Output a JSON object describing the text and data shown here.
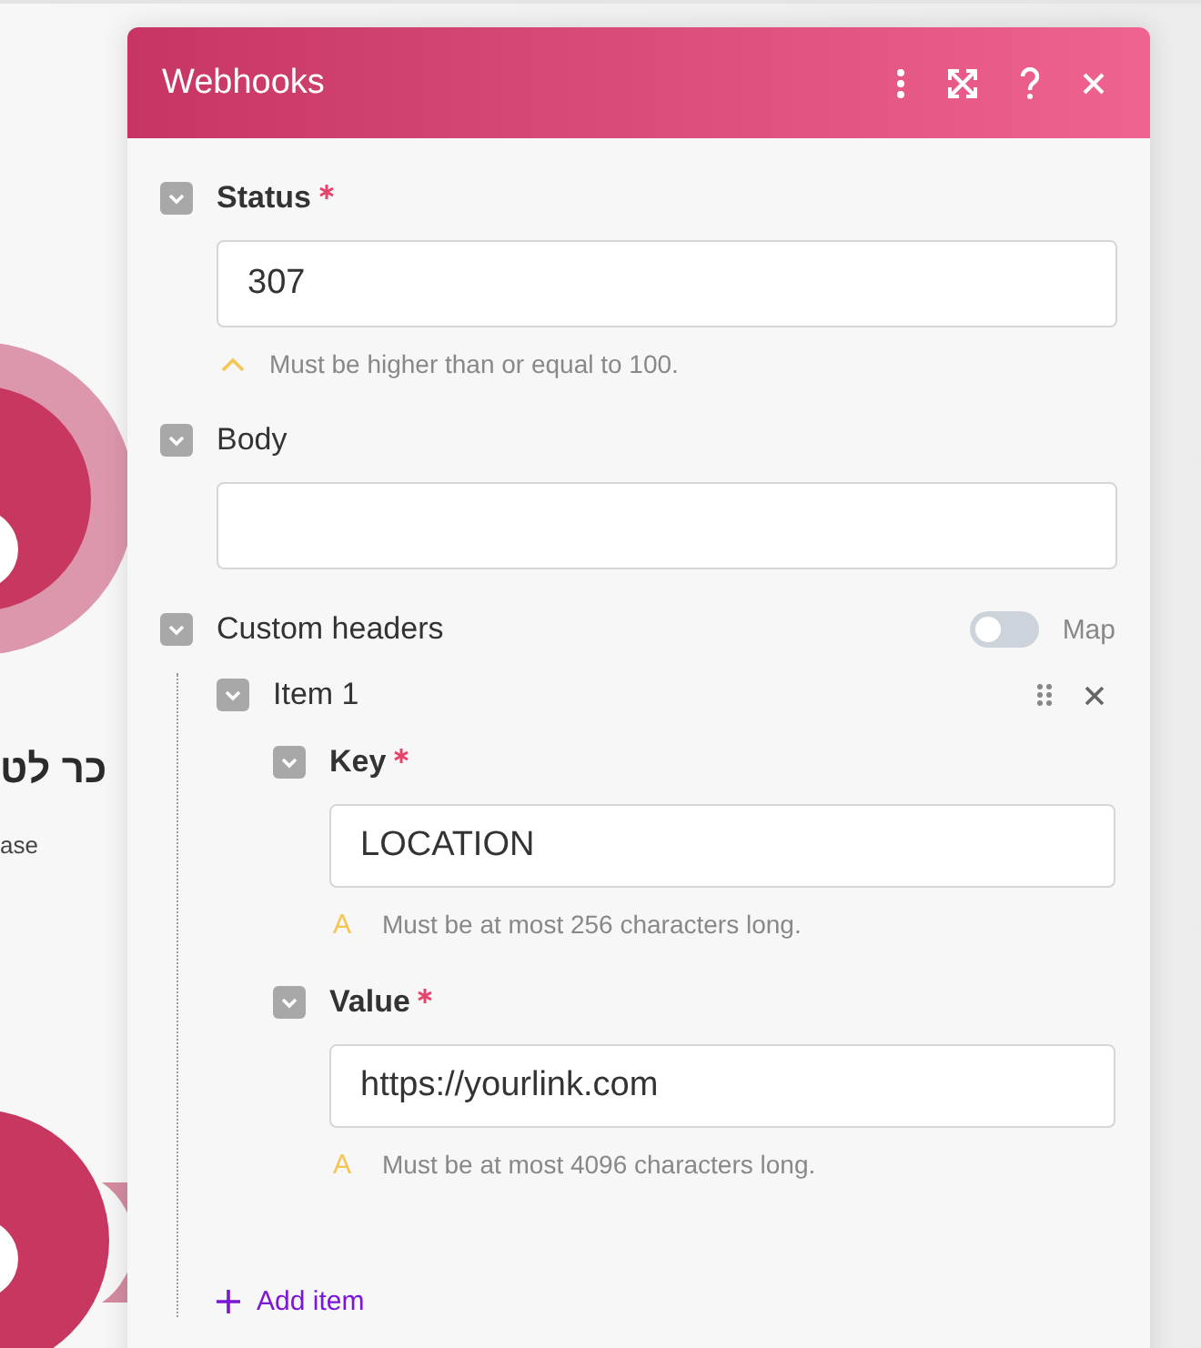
{
  "canvas": {
    "labels": [
      {
        "text": "כר לט",
        "kind": "title"
      },
      {
        "text": "ase",
        "kind": "subtitle"
      }
    ]
  },
  "panel": {
    "title": "Webhooks",
    "fields": [
      {
        "kind": "input",
        "label": "Status",
        "required": true,
        "expanded": true,
        "value": "307",
        "hint": {
          "kind": "range",
          "text": "Must be higher than or equal to 100."
        }
      },
      {
        "kind": "input",
        "label": "Body",
        "required": false,
        "expanded": true
      },
      {
        "kind": "array",
        "label": "Custom headers",
        "required": false,
        "expanded": true,
        "toggle": {
          "label": "Map",
          "on": false
        },
        "items": [
          {
            "label": "Item 1",
            "expanded": true,
            "fields": [
              {
                "kind": "input",
                "label": "Key",
                "required": true,
                "expanded": true,
                "value": "LOCATION",
                "hint": {
                  "kind": "length",
                  "icon": "A",
                  "text": "Must be at most 256 characters long."
                }
              },
              {
                "kind": "input",
                "label": "Value",
                "required": true,
                "expanded": true,
                "value": "https://yourlink.com",
                "hint": {
                  "kind": "length",
                  "icon": "A",
                  "text": "Must be at most 4096 characters long."
                }
              }
            ]
          }
        ],
        "add_label": "Add item"
      }
    ]
  }
}
